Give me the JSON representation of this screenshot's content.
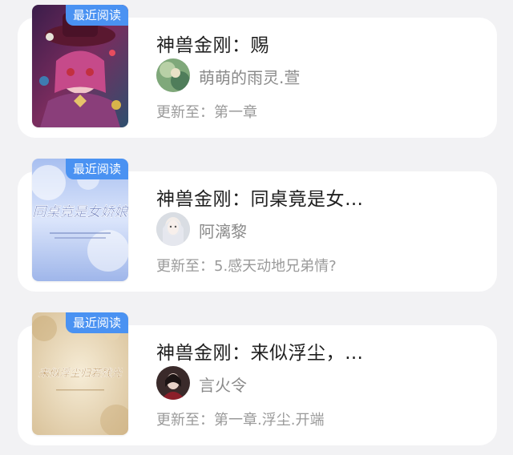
{
  "books": [
    {
      "badge": "最近阅读",
      "title": "神兽金刚：赐",
      "author": "萌萌的雨灵.萱",
      "update_prefix": "更新至：",
      "update_chapter": "第一章",
      "cover_art": "anime-witch-red-purple"
    },
    {
      "badge": "最近阅读",
      "title": "神兽金刚：同桌竟是女…",
      "author": "阿漓黎",
      "update_prefix": "更新至：",
      "update_chapter": "5.感天动地兄弟情?",
      "cover_art": "sky-blue-calligraphy",
      "cover_text": "同桌竟是女娇娘"
    },
    {
      "badge": "最近阅读",
      "title": "神兽金刚：来似浮尘，…",
      "author": "言火令",
      "update_prefix": "更新至：",
      "update_chapter": "第一章.浮尘.开端",
      "cover_art": "parchment-calligraphy",
      "cover_text": "来似浮尘归若残光"
    }
  ],
  "colors": {
    "badge_bg": "#4a92f2",
    "card_bg": "#ffffff",
    "page_bg": "#f2f2f4",
    "title_text": "#1f1f1f",
    "meta_text": "#9a9a9a"
  }
}
